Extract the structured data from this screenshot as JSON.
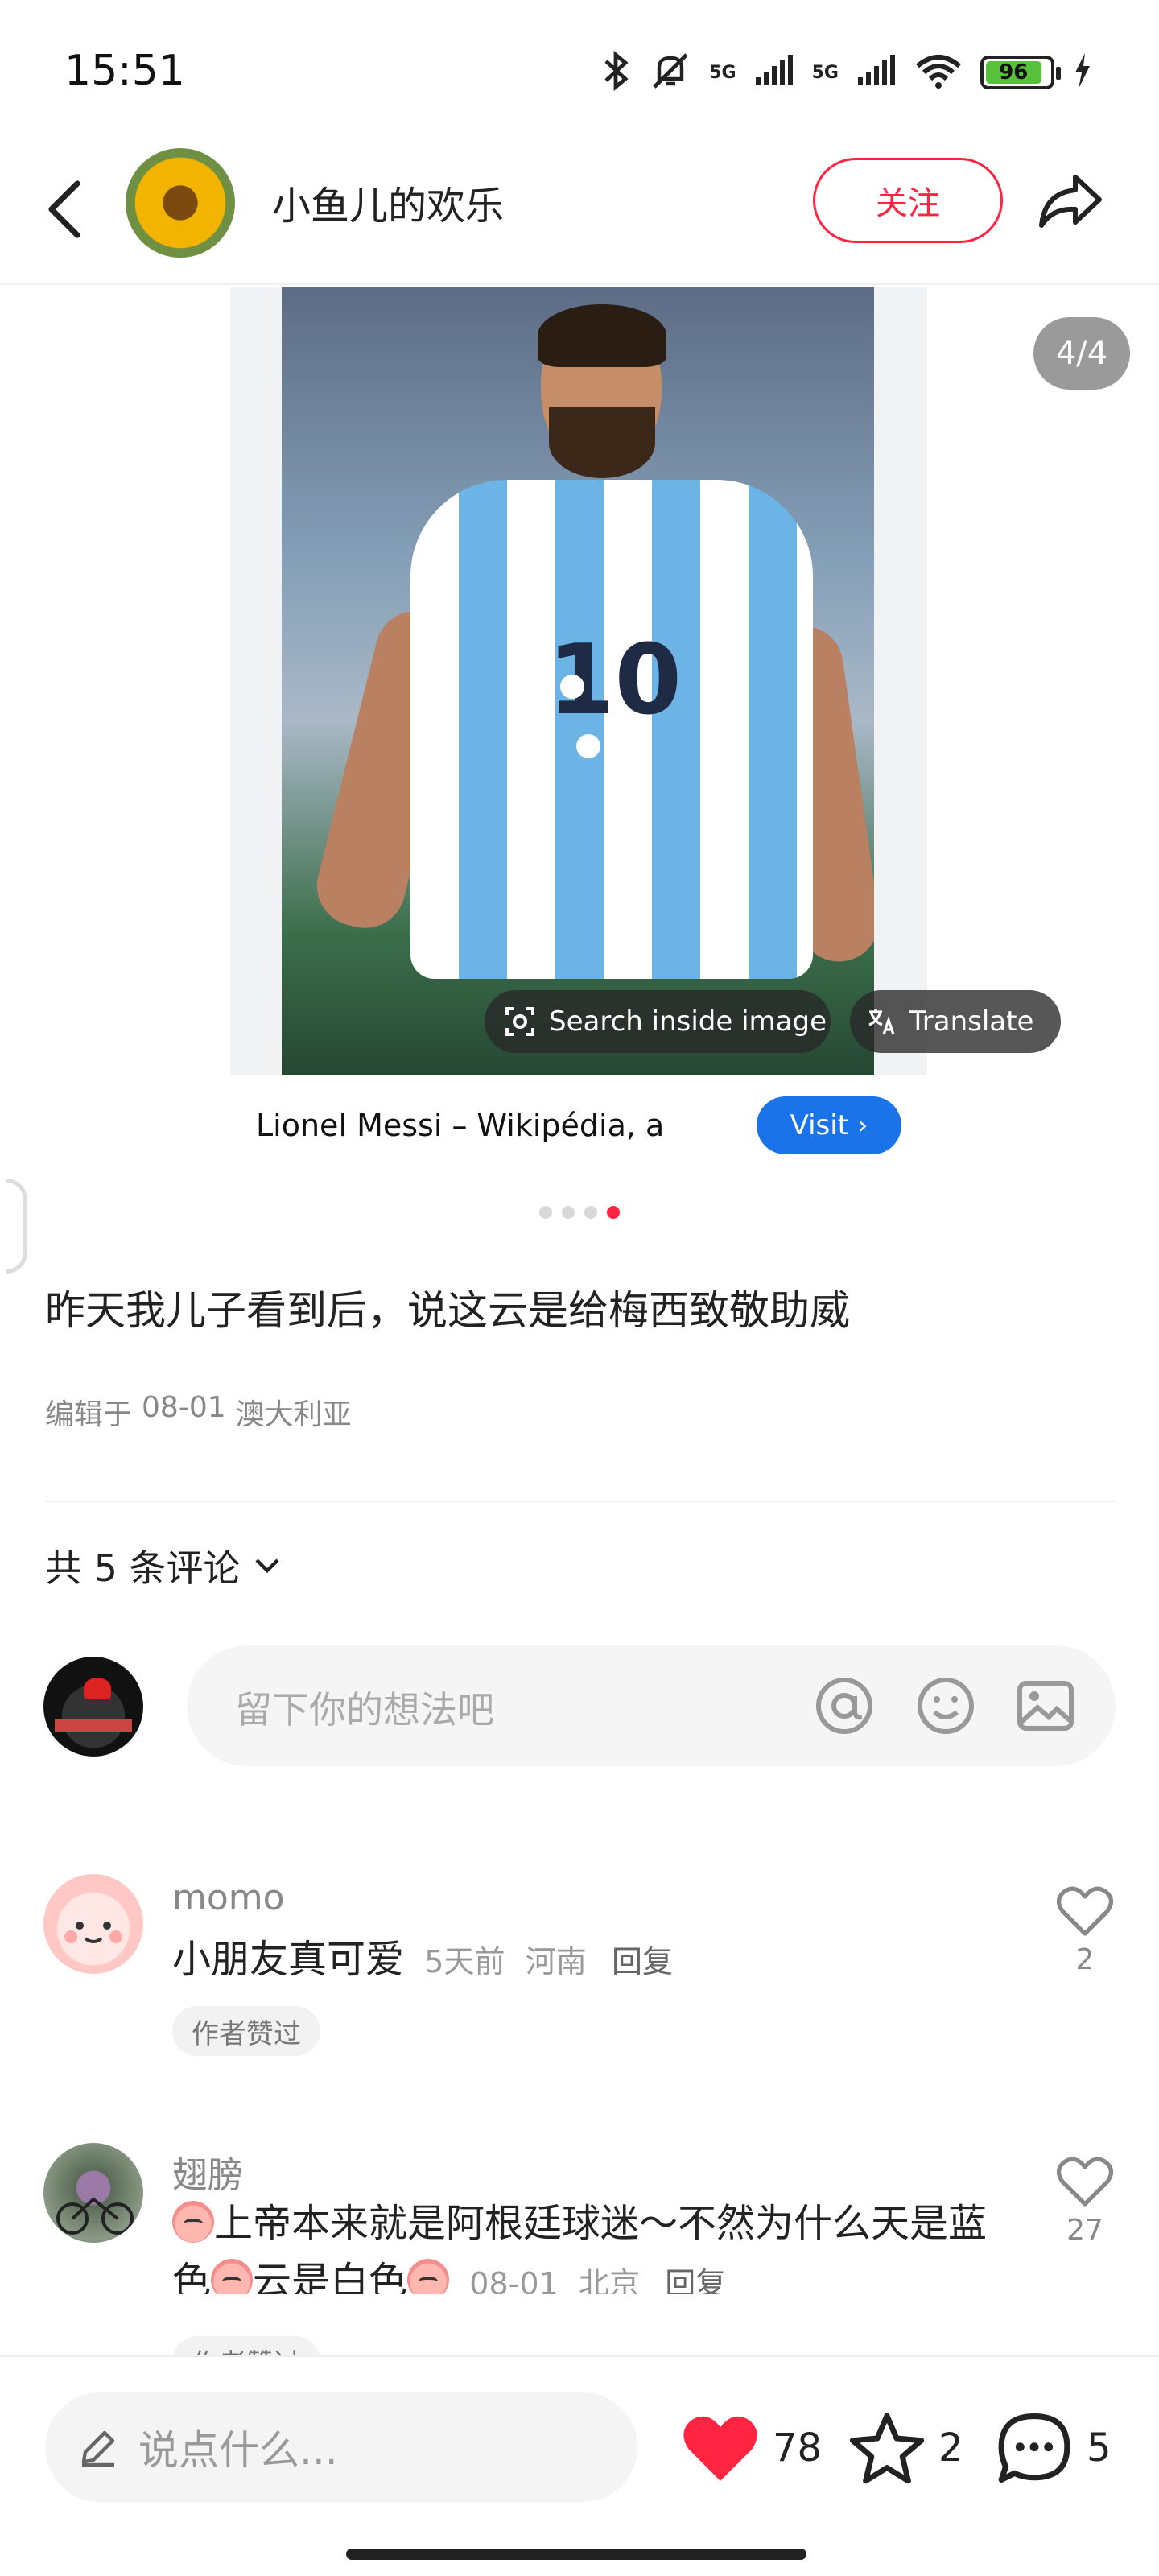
{
  "status_bar": {
    "time": "15:51",
    "network_1": "5G",
    "network_2": "5G",
    "battery": "96"
  },
  "header": {
    "author_name": "小鱼儿的欢乐",
    "follow_label": "关注"
  },
  "media": {
    "page_counter": "4/4",
    "jersey_number": "10",
    "search_inside_label": "Search inside image",
    "translate_label": "Translate",
    "source_title": "Lionel Messi – Wikipédia, a",
    "visit_label": "Visit ›",
    "carousel_total": 4,
    "carousel_active": 4
  },
  "post": {
    "text": "昨天我儿子看到后，说这云是给梅西致敬助威",
    "edited_label": "编辑于",
    "date": "08-01",
    "location": "澳大利亚"
  },
  "comments": {
    "count_label": "共 5 条评论",
    "input_placeholder": "留下你的想法吧",
    "items": [
      {
        "name": "momo",
        "text": "小朋友真可爱",
        "time": "5天前",
        "location": "河南",
        "reply_label": "回复",
        "badge": "作者赞过",
        "likes": "2"
      },
      {
        "name": "翅膀",
        "text_part1": "上帝本来就是阿根廷球迷～不然为什么天是蓝色",
        "text_part2": "云是白色",
        "time": "08-01",
        "location": "北京",
        "reply_label": "回复",
        "badge": "作者赞过",
        "likes": "27"
      }
    ]
  },
  "bottom_bar": {
    "input_placeholder": "说点什么...",
    "likes": "78",
    "collects": "2",
    "comments": "5"
  },
  "colors": {
    "accent": "#ff2442",
    "link_blue": "#1a73e8",
    "muted_text": "#888888"
  }
}
